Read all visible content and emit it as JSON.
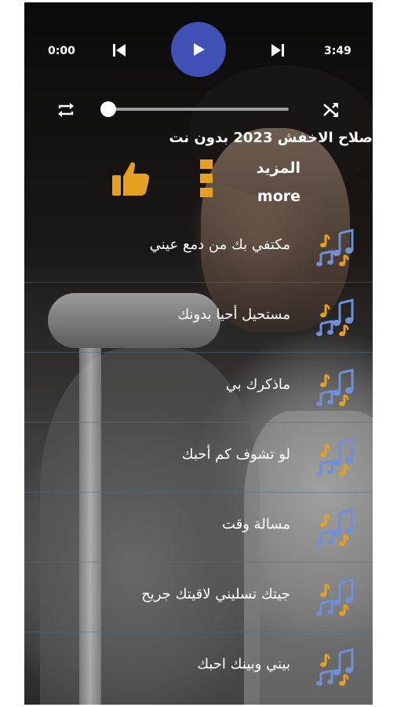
{
  "player": {
    "current_time": "0:00",
    "total_time": "3:49",
    "progress": 0.0,
    "accent_color": "#3f51b5"
  },
  "header": {
    "title": "صلاح الاخفش 2023 بدون نت",
    "more_ar": "المزيد",
    "more_en": "more"
  },
  "icons": {
    "prev": "skip-previous-icon",
    "play": "play-icon",
    "next": "skip-next-icon",
    "repeat": "repeat-icon",
    "shuffle": "shuffle-icon",
    "like": "thumbs-up-icon",
    "menu": "vertical-dots-icon",
    "song": "music-notes-icon"
  },
  "songs": [
    {
      "title": "مكتفي بك من دمع عيني"
    },
    {
      "title": "مستحيل أحيا بدونك"
    },
    {
      "title": "ماذكرك بي"
    },
    {
      "title": "لو تشوف كم أحبك"
    },
    {
      "title": "مسالة وقت"
    },
    {
      "title": "جيتك تسليني لاقيتك جريح"
    },
    {
      "title": "بيني وبينك احبك"
    }
  ]
}
